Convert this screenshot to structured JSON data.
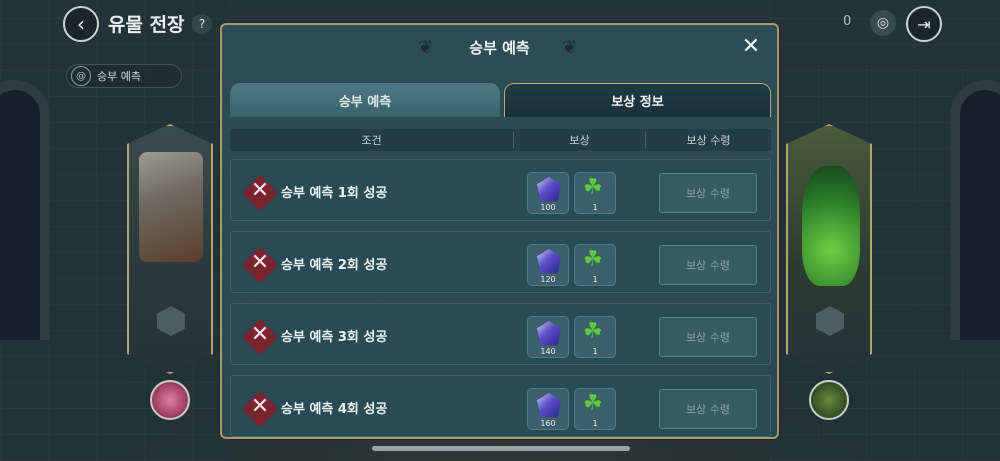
{
  "top_bar": {
    "title": "유물 전장",
    "help": "?",
    "count": "0",
    "back_glyph": "‹",
    "exit_glyph": "⇥",
    "target_glyph": "◎"
  },
  "side_pill": {
    "label": "승부 예측",
    "icon": "spiral-icon"
  },
  "modal": {
    "title": "승부 예측",
    "close": "✕",
    "tabs": [
      {
        "label": "승부 예측",
        "active": false
      },
      {
        "label": "보상 정보",
        "active": true
      }
    ],
    "columns": {
      "condition": "조건",
      "reward": "보상",
      "claim": "보상 수령"
    },
    "rows": [
      {
        "condition": "승부 예측 1회 성공",
        "crystal_qty": "100",
        "clover_qty": "1",
        "claim": "보상 수령"
      },
      {
        "condition": "승부 예측 2회 성공",
        "crystal_qty": "120",
        "clover_qty": "1",
        "claim": "보상 수령"
      },
      {
        "condition": "승부 예측 3회 성공",
        "crystal_qty": "140",
        "clover_qty": "1",
        "claim": "보상 수령"
      },
      {
        "condition": "승부 예측 4회 성공",
        "crystal_qty": "160",
        "clover_qty": "1",
        "claim": "보상 수령"
      }
    ]
  },
  "colors": {
    "modal_bg": "#2c4c56",
    "border_gold": "#a99a68",
    "fail_red": "#7a2430",
    "crystal_purple": "#5b4fc9",
    "clover_green": "#5ccb3d"
  }
}
